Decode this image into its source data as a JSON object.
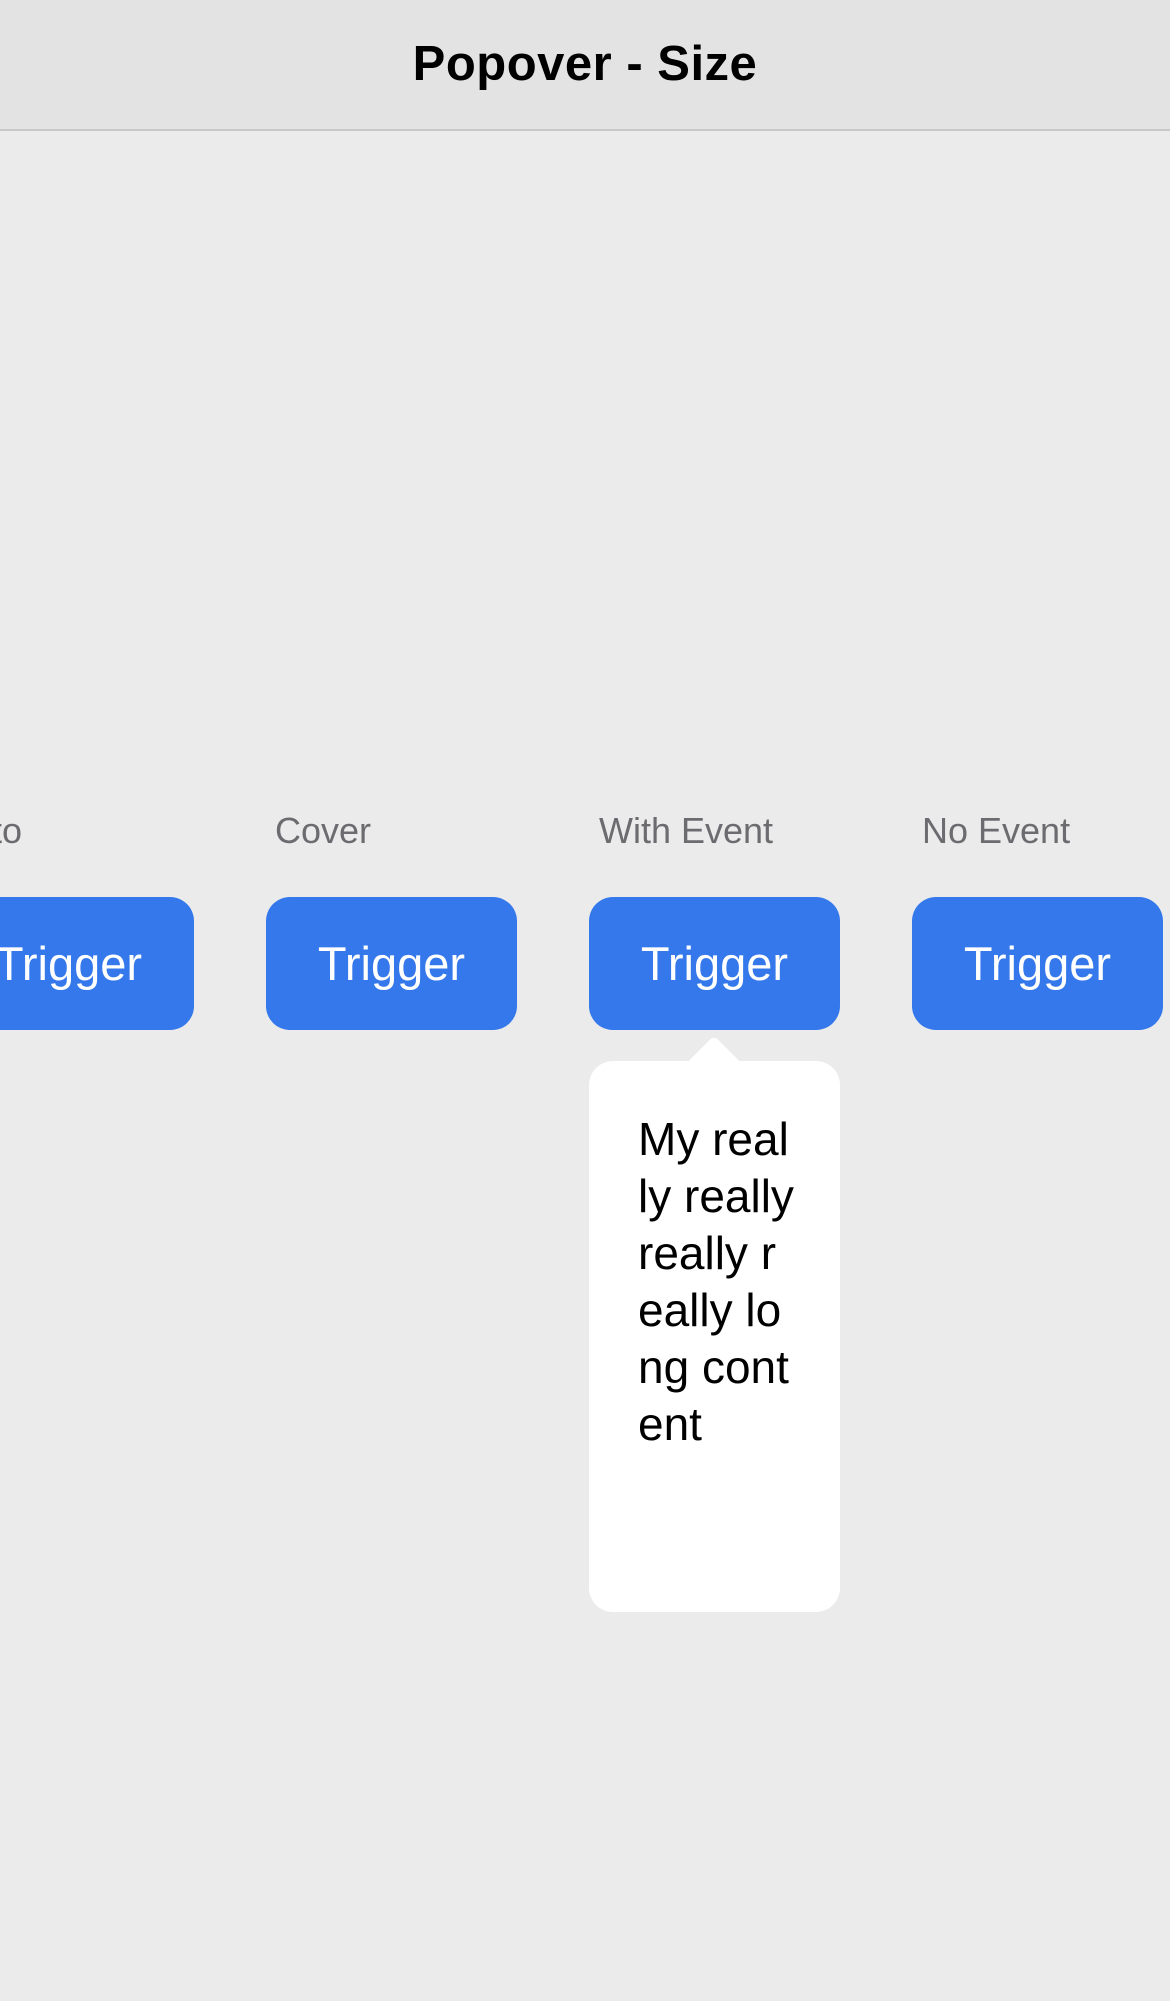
{
  "nav": {
    "title": "Popover - Size"
  },
  "columns": [
    {
      "label": "to",
      "button_label": "Trigger"
    },
    {
      "label": "Cover",
      "button_label": "Trigger"
    },
    {
      "label": "With Event",
      "button_label": "Trigger"
    },
    {
      "label": "No Event",
      "button_label": "Trigger"
    }
  ],
  "popover": {
    "text": "My really really really really long content"
  },
  "colors": {
    "accent": "#3478eb",
    "background": "#ebebeb",
    "navbar": "#e3e3e3",
    "label": "#6c6c70",
    "popover": "#ffffff"
  }
}
